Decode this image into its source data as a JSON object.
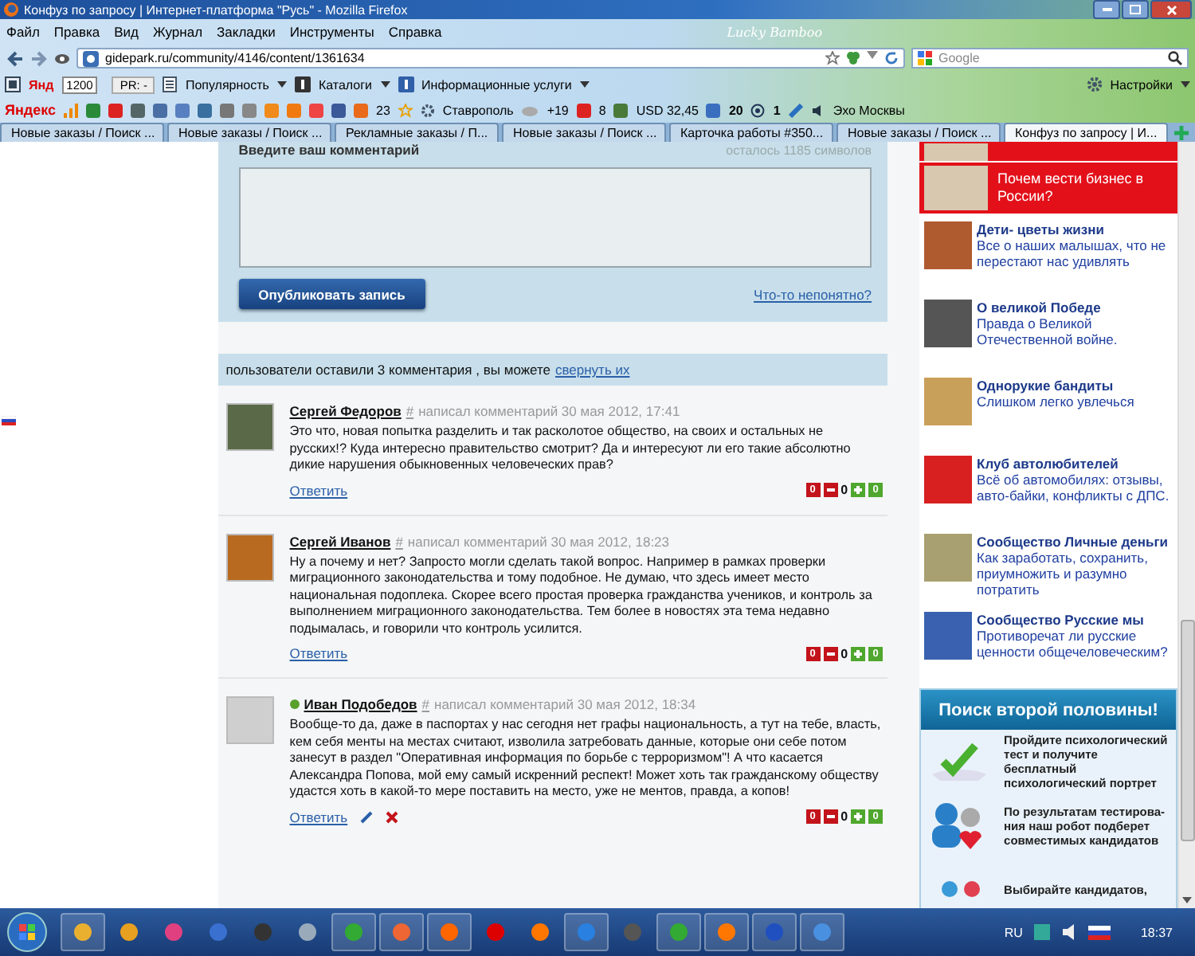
{
  "window": {
    "title": "Конфуз по запросу | Интернет-платформа \"Русь\" - Mozilla Firefox"
  },
  "menu": [
    "Файл",
    "Правка",
    "Вид",
    "Журнал",
    "Закладки",
    "Инструменты",
    "Справка"
  ],
  "theme_name": "Lucky Bamboo",
  "address": {
    "url": "gidepark.ru/community/4146/content/1361634"
  },
  "search": {
    "placeholder": "Google"
  },
  "toolbar": {
    "label": "Янд",
    "counter": "1200",
    "pr": "PR: -",
    "items": [
      "Популярность",
      "Каталоги",
      "Информационные услуги"
    ],
    "settings": "Настройки"
  },
  "yandex_bar": {
    "logo": "Яндекс",
    "mail_count": "23",
    "city": "Ставрополь",
    "temperature": "+19",
    "traffic": "8",
    "currency": "USD 32,45",
    "messages": "20",
    "at_count": "1",
    "radio": "Эхо Москвы"
  },
  "tabs": [
    {
      "label": "Новые заказы / Поиск ...",
      "selected": false
    },
    {
      "label": "Новые заказы / Поиск ...",
      "selected": false
    },
    {
      "label": "Рекламные заказы / П...",
      "selected": false
    },
    {
      "label": "Новые заказы / Поиск ...",
      "selected": false
    },
    {
      "label": "Карточка работы #350...",
      "selected": false
    },
    {
      "label": "Новые заказы / Поиск ...",
      "selected": false
    },
    {
      "label": "Конфуз по запросу | И...",
      "selected": true
    }
  ],
  "comment_form": {
    "label": "Введите ваш комментарий",
    "remaining": "осталось 1185 символов",
    "submit": "Опубликовать запись",
    "help_link": "Что-то непонятно?"
  },
  "comments_bar": {
    "text": "пользователи оставили 3 комментария , вы можете",
    "link": "свернуть их"
  },
  "comments": [
    {
      "author": "Сергей Федоров",
      "online": false,
      "permalink": "#",
      "meta": "написал комментарий 30 мая 2012, 17:41",
      "text": "Это что, новая попытка разделить и так расколотое общество, на своих и остальных не русских!? Куда интересно правительство смотрит? Да и интересуют ли его такие абсолютно дикие нарушения обыкновенных человеческих прав?",
      "reply": "Ответить",
      "editable": false,
      "votes": {
        "minus_count": "0",
        "score": "0",
        "plus_count": "0"
      }
    },
    {
      "author": "Сергей Иванов",
      "online": false,
      "permalink": "#",
      "meta": "написал комментарий 30 мая 2012, 18:23",
      "text": "Ну а почему и нет? Запросто могли сделать такой вопрос. Например в рамках проверки миграционного законодательства и тому подобное. Не думаю, что здесь имеет место национальная подоплека. Скорее всего простая проверка гражданства учеников, и контроль за выполнением миграционного законодательства. Тем более в новостях эта тема недавно подымалась, и говорили что контроль усилится.",
      "reply": "Ответить",
      "editable": false,
      "votes": {
        "minus_count": "0",
        "score": "0",
        "plus_count": "0"
      }
    },
    {
      "author": "Иван Подобедов",
      "online": true,
      "permalink": "#",
      "meta": "написал комментарий 30 мая 2012, 18:34",
      "text": "Вообще-то да, даже в паспортах у нас сегодня нет графы национальность, а тут на тебе, власть, кем себя менты на местах считают, изволила затребовать данные, которые они себе потом занесут в раздел \"Оперативная информация по борьбе с терроризмом\"! А что касается Александра Попова, мой ему самый искренний респект! Может хоть так гражданскому обществу удастся хоть в какой-то мере поставить на место, уже не ментов, правда, а копов!",
      "reply": "Ответить",
      "editable": true,
      "votes": {
        "minus_count": "0",
        "score": "0",
        "plus_count": "0"
      }
    }
  ],
  "sidebar": {
    "featured": [
      {
        "title": "Почем вести бизнес в России?"
      }
    ],
    "communities": [
      {
        "title": "Дети- цветы жизни",
        "description": "Все о наших малышах, что не перестают нас удивлять"
      },
      {
        "title": "О великой Победе",
        "description": "Правда о Великой Отечественной войне."
      },
      {
        "title": "Однорукие бандиты",
        "description": "Слишком легко увлечься"
      },
      {
        "title": "Клуб автолюбителей",
        "description": "Всё об автомобилях: отзывы, авто-байки, конфликты с ДПС."
      },
      {
        "title": "Сообщество Личные деньги",
        "description": "Как заработать, сохранить, приумножить и разумно потратить"
      },
      {
        "title": "Сообщество Русские мы",
        "description": "Противоречат ли русские ценности общечеловеческим?"
      }
    ],
    "promo": {
      "title": "Поиск второй половины!",
      "steps": [
        {
          "kind": "test",
          "text": "Пройдите психологический тест и получите бесплатный психологический портрет"
        },
        {
          "kind": "match",
          "text": "По результатам тестирова-ния наш робот подберет совместимых кандидатов"
        },
        {
          "kind": "choose",
          "text": "Выбирайте кандидатов,"
        }
      ]
    }
  },
  "taskbar": {
    "language": "RU",
    "clock": "18:37"
  }
}
